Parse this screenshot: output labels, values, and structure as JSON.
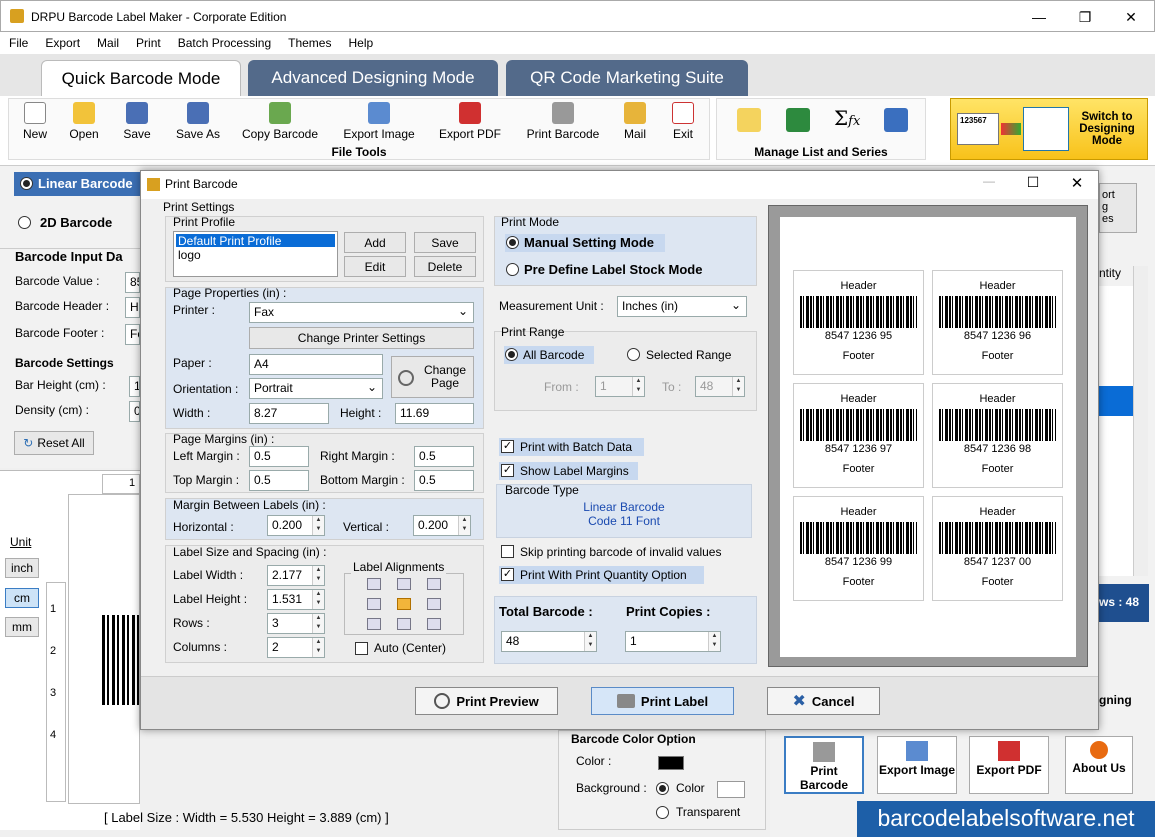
{
  "app": {
    "title": "DRPU Barcode Label Maker - Corporate Edition"
  },
  "menu": [
    "File",
    "Export",
    "Mail",
    "Print",
    "Batch Processing",
    "Themes",
    "Help"
  ],
  "tabs": [
    "Quick Barcode Mode",
    "Advanced Designing Mode",
    "QR Code Marketing Suite"
  ],
  "toolbar": {
    "buttons": [
      "New",
      "Open",
      "Save",
      "Save As",
      "Copy Barcode",
      "Export Image",
      "Export PDF",
      "Print Barcode",
      "Mail",
      "Exit"
    ],
    "file_tools": "File Tools",
    "manage": "Manage List and Series",
    "switch": "Switch to Designing Mode",
    "switch_icon_text": "123567"
  },
  "left": {
    "linear": "Linear Barcode",
    "twod": "2D Barcode",
    "input_title": "Barcode Input Da",
    "value_label": "Barcode Value :",
    "value": "85",
    "header_label": "Barcode Header :",
    "header": "He",
    "footer_label": "Barcode Footer :",
    "footer": "Fo",
    "settings_title": "Barcode Settings",
    "bar_height": "Bar Height (cm) :",
    "bar_height_v": "1",
    "density": "Density (cm) :",
    "density_v": "0",
    "reset": "Reset All",
    "unit": "Unit",
    "inch": "inch",
    "cm": "cm",
    "mm": "mm",
    "ruler_top": "1",
    "ruler": [
      "1",
      "2",
      "3",
      "4"
    ]
  },
  "status": "[ Label Size : Width = 5.530   Height = 3.889 (cm) ]",
  "right": {
    "port": "ort",
    "ng": "g",
    "es": "es",
    "tity": "ntity",
    "ws": "ws : 48",
    "gning": "gning"
  },
  "color_option": {
    "title": "Barcode Color Option",
    "color": "Color :",
    "background": "Background :",
    "color_opt": "Color",
    "transparent": "Transparent",
    "swatch": "#000000"
  },
  "bottom_tools": [
    "Print Barcode",
    "Export Image",
    "Export PDF",
    "About Us"
  ],
  "watermark": "barcodelabelsoftware.net",
  "dialog": {
    "title": "Print Barcode",
    "print_settings": "Print Settings",
    "print_profile": "Print Profile",
    "profiles": [
      "Default Print Profile",
      "logo"
    ],
    "add": "Add",
    "save": "Save",
    "edit": "Edit",
    "delete": "Delete",
    "page_props": "Page Properties (in) :",
    "printer_label": "Printer :",
    "printer": "Fax",
    "change_printer": "Change Printer Settings",
    "paper_label": "Paper :",
    "paper": "A4",
    "change_page": "Change Page",
    "orientation_label": "Orientation :",
    "orientation": "Portrait",
    "width_label": "Width :",
    "width": "8.27",
    "height_label": "Height :",
    "height": "11.69",
    "margins": "Page Margins (in) :",
    "left_m": "Left Margin :",
    "left_v": "0.5",
    "right_m": "Right Margin :",
    "right_v": "0.5",
    "top_m": "Top Margin :",
    "top_v": "0.5",
    "bottom_m": "Bottom Margin :",
    "bottom_v": "0.5",
    "between": "Margin Between Labels (in) :",
    "horizontal": "Horizontal :",
    "horizontal_v": "0.200",
    "vertical": "Vertical :",
    "vertical_v": "0.200",
    "size_spacing": "Label Size and Spacing (in) :",
    "label_width": "Label Width :",
    "label_width_v": "2.177",
    "label_height": "Label Height :",
    "label_height_v": "1.531",
    "rows": "Rows :",
    "rows_v": "3",
    "columns": "Columns :",
    "columns_v": "2",
    "alignments": "Label Alignments",
    "auto": "Auto (Center)",
    "print_mode": "Print Mode",
    "manual": "Manual Setting Mode",
    "predefine": "Pre Define Label Stock Mode",
    "measurement": "Measurement Unit :",
    "measurement_v": "Inches (in)",
    "print_range": "Print Range",
    "all": "All Barcode",
    "selected": "Selected Range",
    "from": "From :",
    "from_v": "1",
    "to": "To :",
    "to_v": "48",
    "batch": "Print with Batch Data",
    "show_margins": "Show Label Margins",
    "barcode_type": "Barcode Type",
    "type1": "Linear Barcode",
    "type2": "Code 11 Font",
    "skip": "Skip printing barcode of invalid values",
    "quantity": "Print With Print Quantity Option",
    "total": "Total Barcode :",
    "total_v": "48",
    "copies": "Print Copies :",
    "copies_v": "1",
    "preview_btn": "Print Preview",
    "print_btn": "Print Label",
    "cancel_btn": "Cancel",
    "labels": [
      {
        "header": "Header",
        "num": "8547 1236 95",
        "footer": "Footer"
      },
      {
        "header": "Header",
        "num": "8547 1236 96",
        "footer": "Footer"
      },
      {
        "header": "Header",
        "num": "8547 1236 97",
        "footer": "Footer"
      },
      {
        "header": "Header",
        "num": "8547 1236 98",
        "footer": "Footer"
      },
      {
        "header": "Header",
        "num": "8547 1236 99",
        "footer": "Footer"
      },
      {
        "header": "Header",
        "num": "8547 1237 00",
        "footer": "Footer"
      }
    ]
  }
}
